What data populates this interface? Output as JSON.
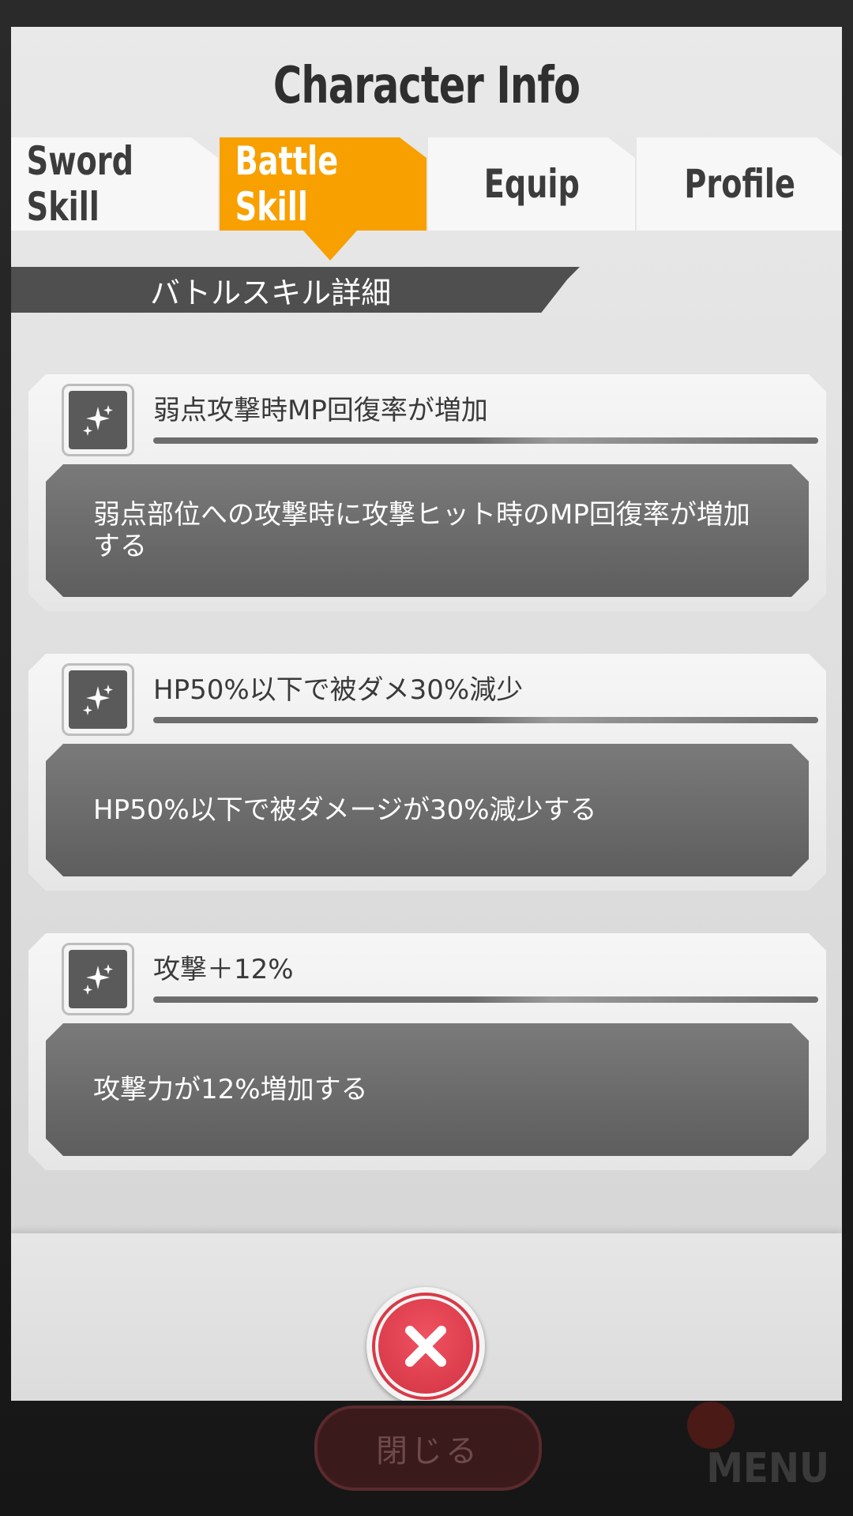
{
  "modal": {
    "title": "Character Info"
  },
  "tabs": [
    {
      "label": "Sword Skill",
      "active": false
    },
    {
      "label": "Battle Skill",
      "active": true
    },
    {
      "label": "Equip",
      "active": false
    },
    {
      "label": "Profile",
      "active": false
    }
  ],
  "section": {
    "title": "バトルスキル詳細"
  },
  "skills": [
    {
      "name": "弱点攻撃時MP回復率が増加",
      "description": "弱点部位への攻撃時に攻撃ヒット時のMP回復率が増加する",
      "icon": "sparkle-icon"
    },
    {
      "name": "HP50%以下で被ダメ30%減少",
      "description": "HP50%以下で被ダメージが30%減少する",
      "icon": "sparkle-icon"
    },
    {
      "name": "攻撃＋12%",
      "description": "攻撃力が12%増加する",
      "icon": "sparkle-icon"
    }
  ],
  "footer": {
    "close_icon": "close-icon"
  },
  "background": {
    "close_label": "閉じる",
    "menu_label": "MENU"
  },
  "colors": {
    "accent": "#f7a000",
    "close_red": "#d33343",
    "desc_box": "#6a6a6a"
  }
}
